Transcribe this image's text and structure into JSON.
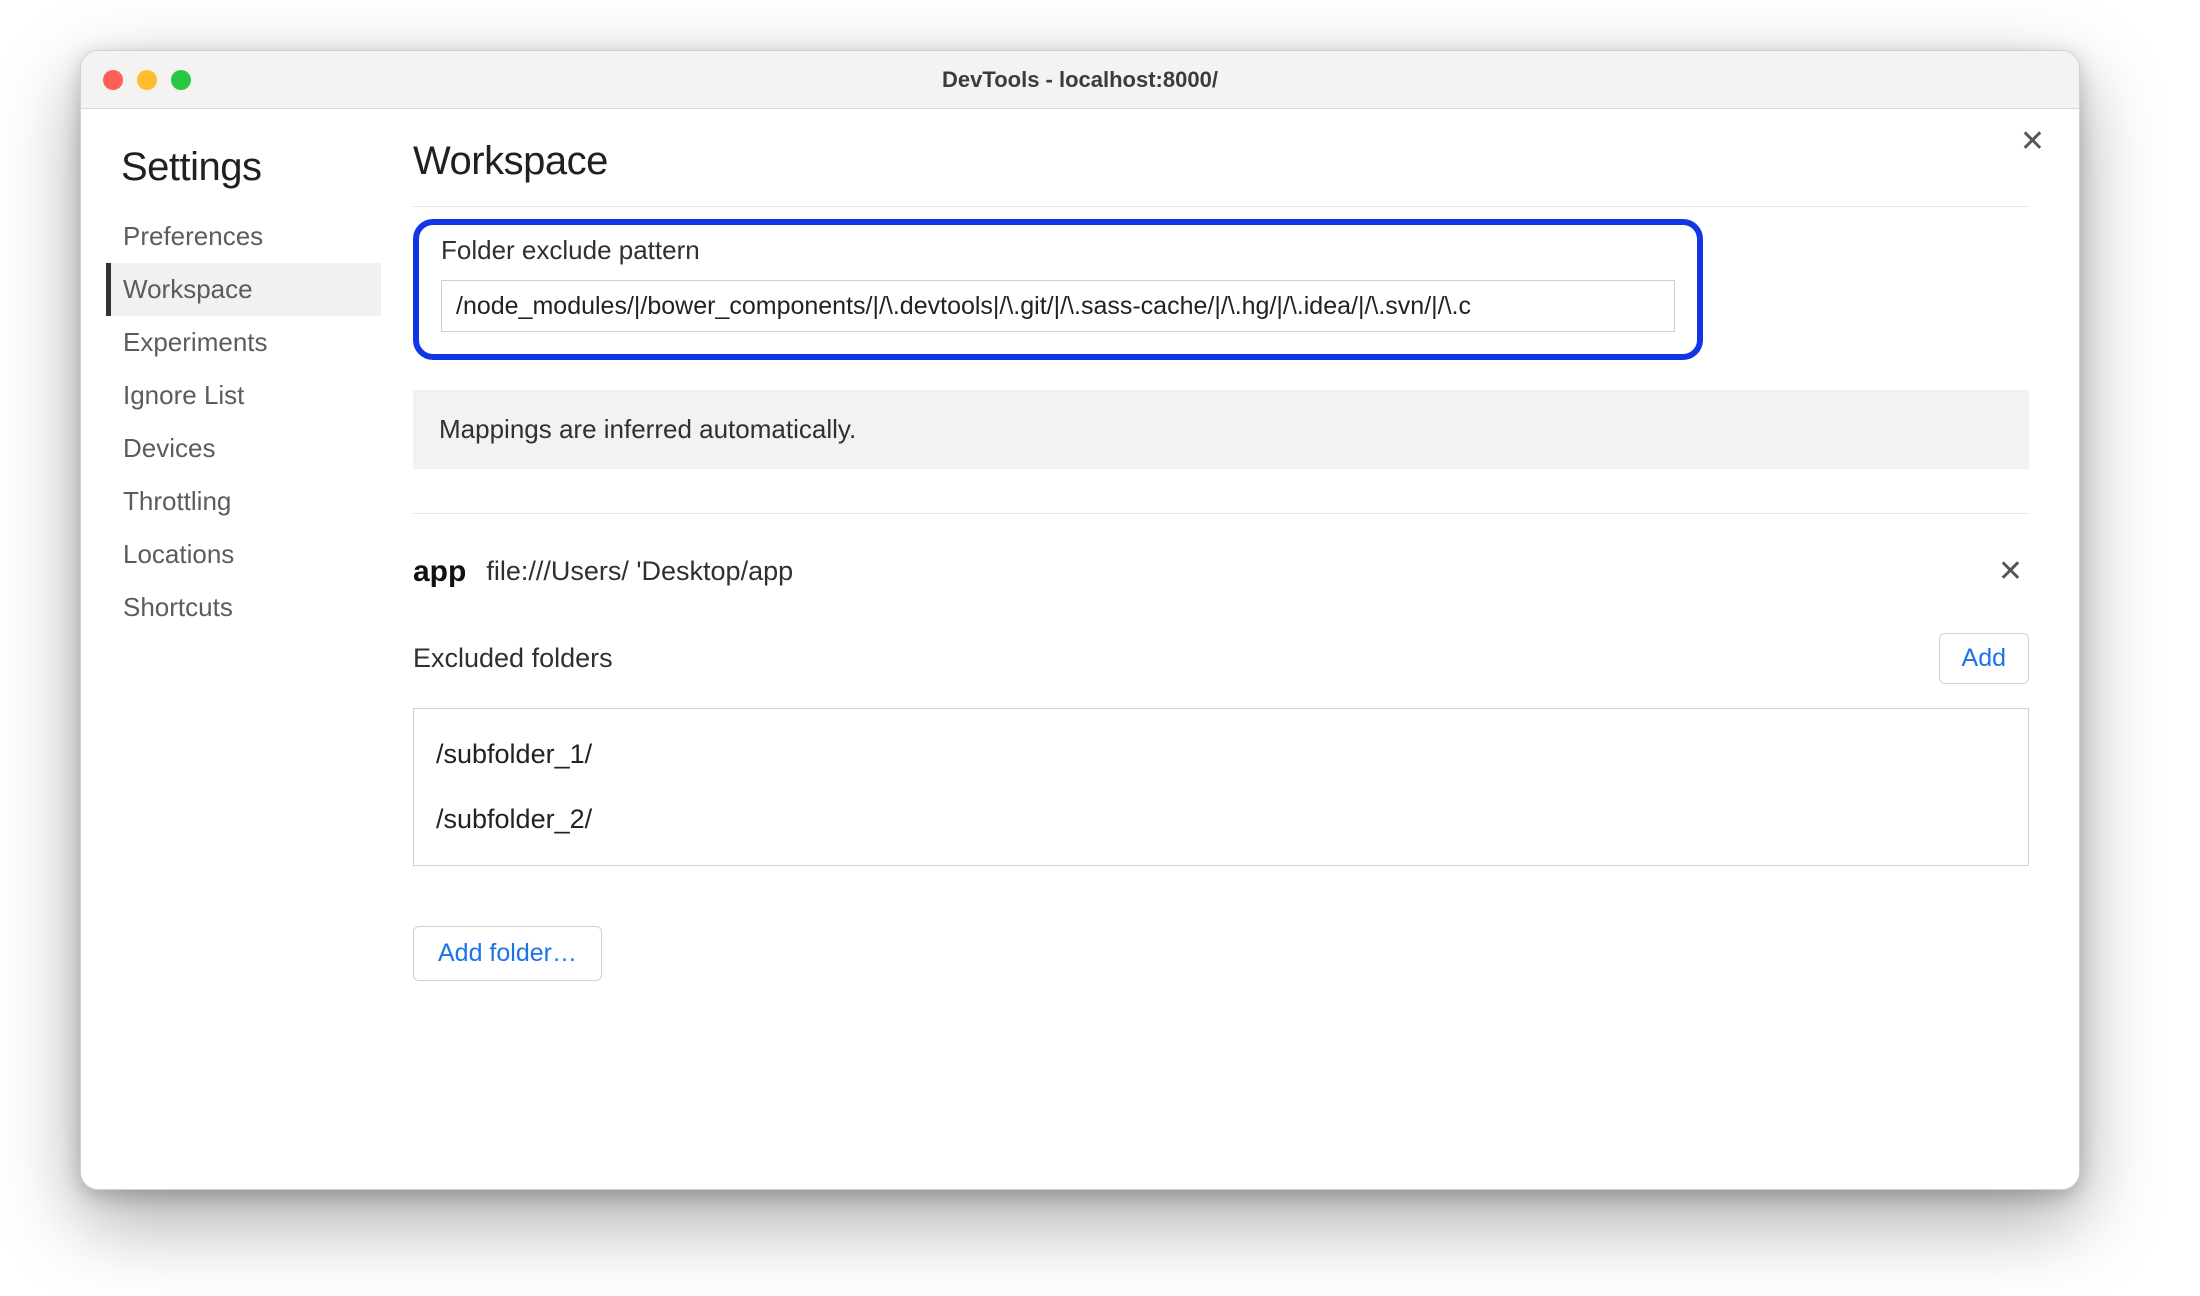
{
  "window": {
    "title": "DevTools - localhost:8000/"
  },
  "sidebar": {
    "title": "Settings",
    "items": [
      {
        "label": "Preferences",
        "active": false
      },
      {
        "label": "Workspace",
        "active": true
      },
      {
        "label": "Experiments",
        "active": false
      },
      {
        "label": "Ignore List",
        "active": false
      },
      {
        "label": "Devices",
        "active": false
      },
      {
        "label": "Throttling",
        "active": false
      },
      {
        "label": "Locations",
        "active": false
      },
      {
        "label": "Shortcuts",
        "active": false
      }
    ]
  },
  "main": {
    "title": "Workspace",
    "exclude_pattern": {
      "label": "Folder exclude pattern",
      "value": "/node_modules/|/bower_components/|/\\.devtools|/\\.git/|/\\.sass-cache/|/\\.hg/|/\\.idea/|/\\.svn/|/\\.c"
    },
    "info_banner": "Mappings are inferred automatically.",
    "folder": {
      "name": "app",
      "path": "file:///Users/        'Desktop/app"
    },
    "excluded": {
      "label": "Excluded folders",
      "add_label": "Add",
      "items": [
        "/subfolder_1/",
        "/subfolder_2/"
      ]
    },
    "add_folder_label": "Add folder…"
  }
}
